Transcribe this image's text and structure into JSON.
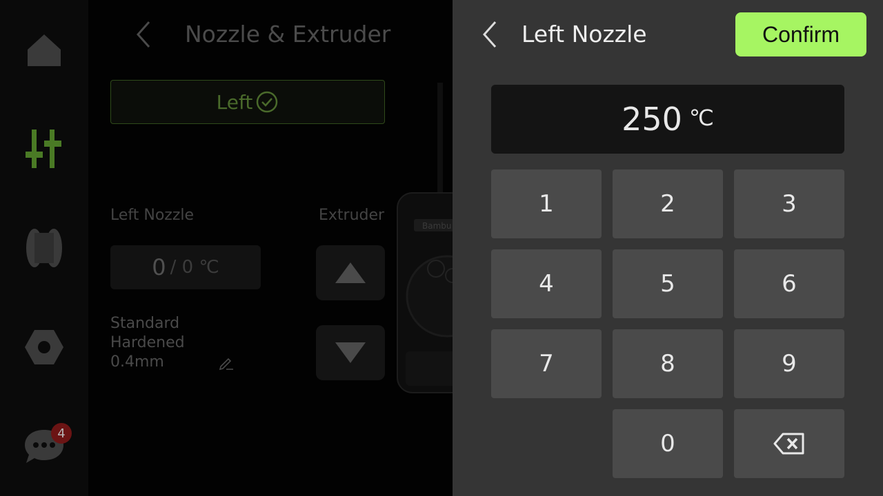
{
  "sidebar": {
    "items": [
      {
        "name": "home",
        "icon": "home-icon"
      },
      {
        "name": "controls",
        "icon": "sliders-icon"
      },
      {
        "name": "filament",
        "icon": "spool-icon"
      },
      {
        "name": "settings",
        "icon": "hex-nut-icon"
      },
      {
        "name": "messages",
        "icon": "chat-bubble-icon"
      }
    ],
    "messages_badge": "4",
    "active_color": "#4a7a25"
  },
  "background_screen": {
    "title": "Nozzle & Extruder",
    "left_tab_label": "Left",
    "left_nozzle_label": "Left Nozzle",
    "extruder_label": "Extruder",
    "nozzle_temp_current": "0",
    "nozzle_temp_target": "/ 0 ℃",
    "nozzle_info": [
      "Standard",
      "Hardened",
      "0.4mm"
    ],
    "extruder_brand_text": "Bambu"
  },
  "keypad_panel": {
    "title": "Left Nozzle",
    "confirm_label": "Confirm",
    "value": "250",
    "unit": "℃",
    "keys": [
      "1",
      "2",
      "3",
      "4",
      "5",
      "6",
      "7",
      "8",
      "9",
      "0"
    ],
    "accent_color": "#a6f562"
  }
}
